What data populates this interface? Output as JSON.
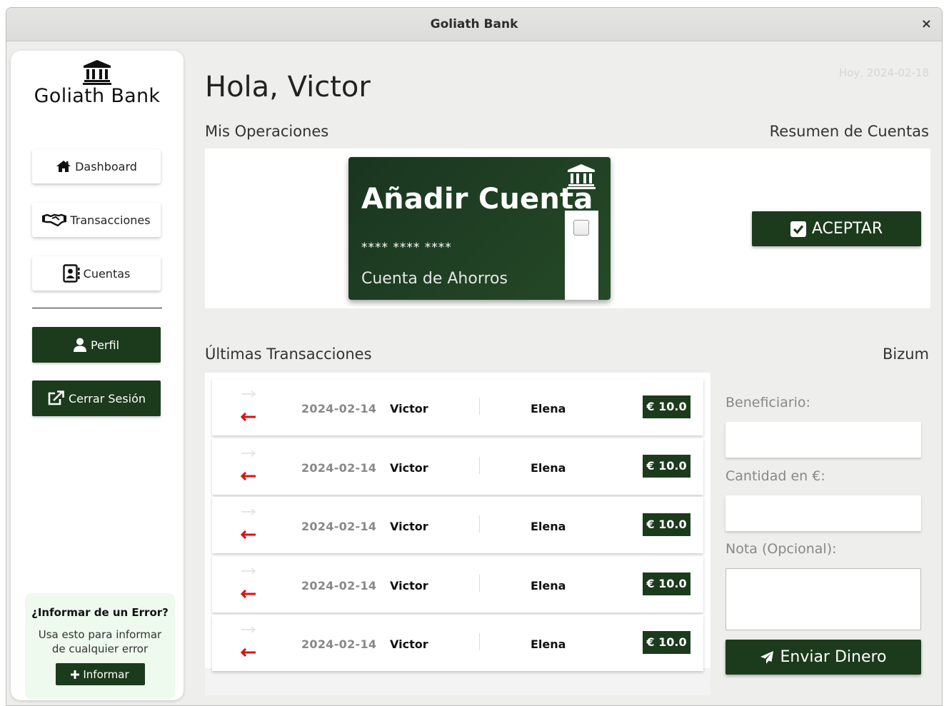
{
  "window": {
    "title": "Goliath Bank",
    "close_label": "×"
  },
  "sidebar": {
    "logo_icon": "bank-icon",
    "logo_text": "Goliath Bank",
    "nav": [
      {
        "label": "Dashboard",
        "icon": "home-icon"
      },
      {
        "label": "Transacciones",
        "icon": "handshake-icon"
      },
      {
        "label": "Cuentas",
        "icon": "contact-card-icon"
      }
    ],
    "profile_label": "Perfil",
    "profile_icon": "user-icon",
    "logout_label": "Cerrar Sesión",
    "logout_icon": "external-link-icon",
    "report": {
      "title": "¿Informar de un Error?",
      "desc": "Usa esto para informar de cualquier error",
      "button_label": "Informar",
      "button_icon": "plus-icon"
    }
  },
  "main": {
    "greeting": "Hola, Victor",
    "date": "Hoy, 2024-02-18",
    "ops_label": "Mis Operaciones",
    "summary_label": "Resumen de Cuentas",
    "card": {
      "title": "Añadir Cuenta",
      "number": "**** **** ****",
      "type": "Cuenta de Ahorros",
      "icon": "bank-icon"
    },
    "accept_label": "ACEPTAR",
    "accept_icon": "check-square-icon",
    "tx_label": "Últimas Transacciones",
    "bizum_label": "Bizum",
    "transactions": [
      {
        "date": "2024-02-14",
        "from": "Victor",
        "to": "Elena",
        "amount": "€ 10.0"
      },
      {
        "date": "2024-02-14",
        "from": "Victor",
        "to": "Elena",
        "amount": "€ 10.0"
      },
      {
        "date": "2024-02-14",
        "from": "Victor",
        "to": "Elena",
        "amount": "€ 10.0"
      },
      {
        "date": "2024-02-14",
        "from": "Victor",
        "to": "Elena",
        "amount": "€ 10.0"
      },
      {
        "date": "2024-02-14",
        "from": "Victor",
        "to": "Elena",
        "amount": "€ 10.0"
      }
    ],
    "bizum": {
      "beneficiary_label": "Beneficiario:",
      "amount_label": "Cantidad en €:",
      "note_label": "Nota (Opcional):",
      "beneficiary_value": "",
      "amount_value": "",
      "note_value": "",
      "send_label": "Enviar Dinero",
      "send_icon": "paper-plane-icon"
    }
  },
  "colors": {
    "accent": "#1c3a1c",
    "incoming_arrow": "#dd1111",
    "outgoing_arrow": "#e6e6e6"
  }
}
